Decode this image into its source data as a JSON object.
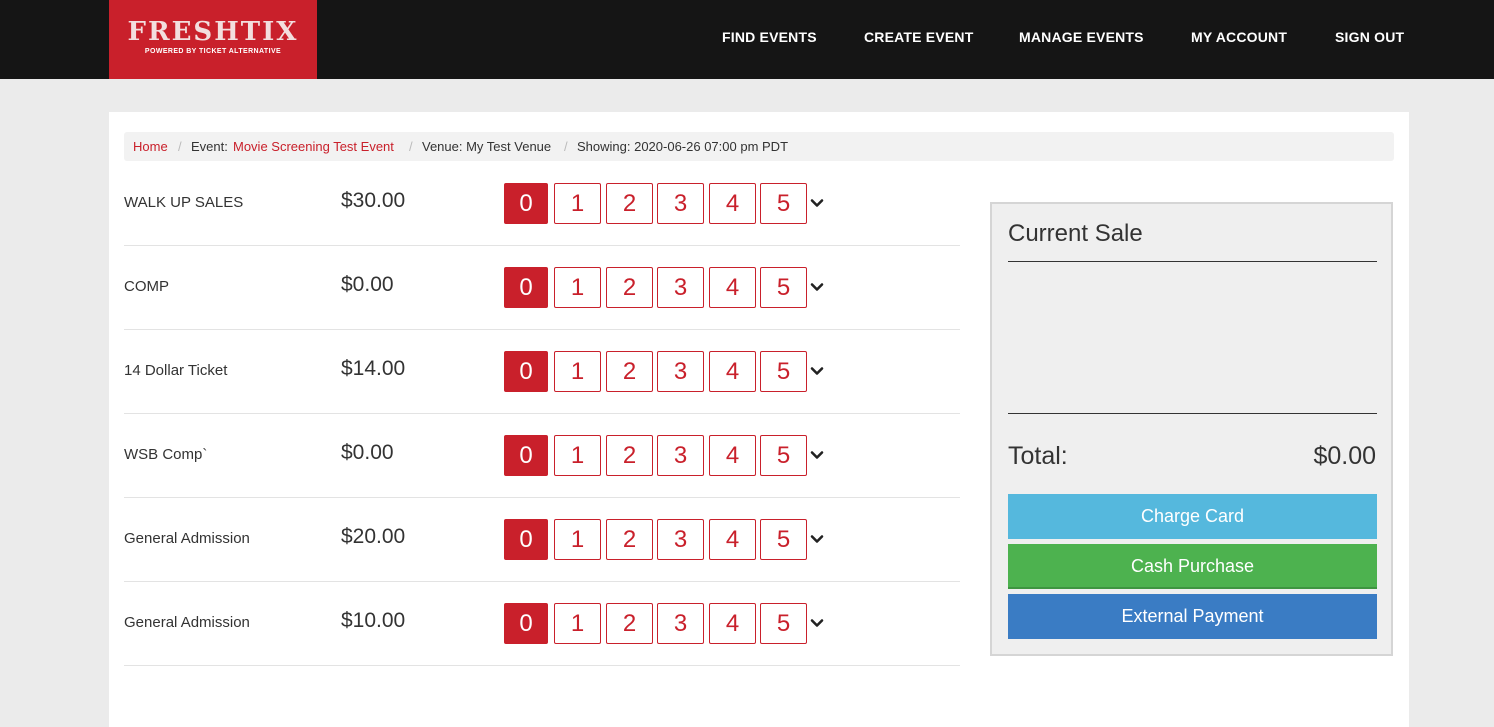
{
  "brand": {
    "name": "FRESHTIX",
    "tagline": "POWERED BY TICKET ALTERNATIVE"
  },
  "nav": [
    "FIND EVENTS",
    "CREATE EVENT",
    "MANAGE EVENTS",
    "MY ACCOUNT",
    "SIGN OUT"
  ],
  "breadcrumb": {
    "home": "Home",
    "event_label": "Event:",
    "event_name": "Movie Screening Test Event",
    "venue": "Venue: My Test Venue",
    "showing": "Showing: 2020-06-26 07:00 pm PDT",
    "separator": "/"
  },
  "tickets": [
    {
      "name": "WALK UP SALES",
      "price": "$30.00"
    },
    {
      "name": "COMP",
      "price": "$0.00"
    },
    {
      "name": "14 Dollar Ticket",
      "price": "$14.00"
    },
    {
      "name": "WSB Comp`",
      "price": "$0.00"
    },
    {
      "name": "General Admission",
      "price": "$20.00"
    },
    {
      "name": "General Admission",
      "price": "$10.00"
    }
  ],
  "quantities": [
    "0",
    "1",
    "2",
    "3",
    "4",
    "5"
  ],
  "selected_quantity": "0",
  "sale": {
    "title": "Current Sale",
    "total_label": "Total:",
    "total_value": "$0.00",
    "charge_card": "Charge Card",
    "cash_purchase": "Cash Purchase",
    "external_payment": "External Payment"
  },
  "colors": {
    "brand_red": "#c9202b",
    "topbar": "#151515",
    "charge": "#55b8dd",
    "cash": "#4db24f",
    "external": "#3a7cc4"
  },
  "icons": {
    "quantity_more": "chevron-down-icon"
  }
}
